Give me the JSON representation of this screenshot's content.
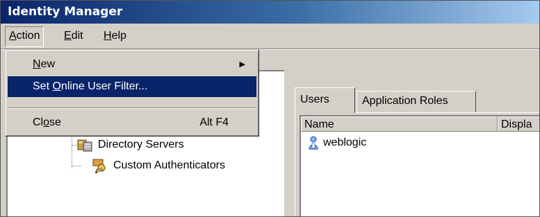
{
  "window": {
    "title": "Identity Manager"
  },
  "menubar": {
    "items": [
      {
        "label": "Action",
        "mnemonic": "A",
        "rest": "ction"
      },
      {
        "label": "Edit",
        "mnemonic": "E",
        "rest": "dit"
      },
      {
        "label": "Help",
        "mnemonic": "H",
        "rest": "elp"
      }
    ]
  },
  "action_menu": {
    "new": {
      "mnemonic": "N",
      "rest": "ew"
    },
    "set_filter": {
      "before": "Set ",
      "mnemonic": "O",
      "rest": "nline User Filter..."
    },
    "close": {
      "before": "Cl",
      "mnemonic": "o",
      "rest": "se",
      "shortcut": "Alt F4"
    }
  },
  "tree": {
    "items": [
      {
        "label": "Directory Servers",
        "icon": "directory-servers-icon"
      },
      {
        "label": "Custom Authenticators",
        "icon": "custom-authenticators-icon"
      }
    ]
  },
  "tabs": [
    {
      "label": "Users",
      "selected": true
    },
    {
      "label": "Application Roles",
      "selected": false
    }
  ],
  "list": {
    "columns": [
      "Name",
      "Displa"
    ],
    "rows": [
      {
        "name": "weblogic",
        "icon": "user-icon"
      }
    ]
  },
  "colors": {
    "selection": "#0a246a",
    "face": "#d4d0c8",
    "title_start": "#0a246a",
    "title_end": "#a6caf0"
  }
}
